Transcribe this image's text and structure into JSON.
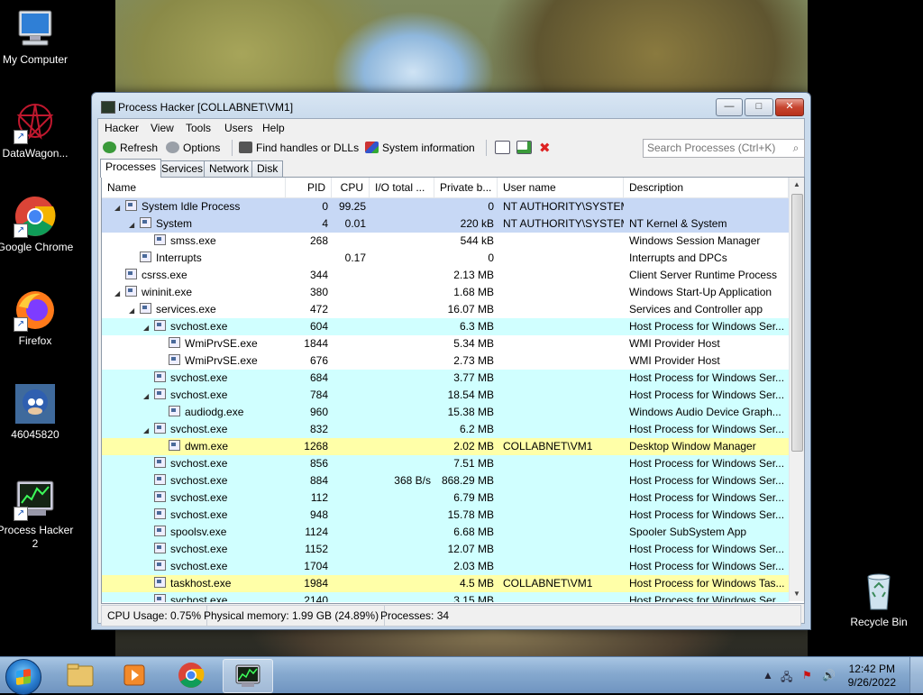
{
  "desktop": {
    "icons": [
      {
        "label": "My Computer",
        "icon": "computer-icon"
      },
      {
        "label": "DataWagon...",
        "icon": "datawagon-icon"
      },
      {
        "label": "Google Chrome",
        "icon": "chrome-icon"
      },
      {
        "label": "Firefox",
        "icon": "firefox-icon"
      },
      {
        "label": "46045820",
        "icon": "image-file-icon"
      },
      {
        "label": "Process Hacker 2",
        "icon": "process-hacker-icon"
      },
      {
        "label": "Recycle Bin",
        "icon": "recycle-bin-icon"
      }
    ]
  },
  "window": {
    "title": "Process Hacker [COLLABNET\\VM1]",
    "controls": {
      "minimize": "—",
      "maximize": "□",
      "close": "✕"
    },
    "menu": [
      "Hacker",
      "View",
      "Tools",
      "Users",
      "Help"
    ],
    "toolbar": {
      "refresh": "Refresh",
      "options": "Options",
      "find_handles": "Find handles or DLLs",
      "system_info": "System information",
      "search_placeholder": "Search Processes (Ctrl+K)"
    },
    "tabs": [
      "Processes",
      "Services",
      "Network",
      "Disk"
    ],
    "active_tab": "Processes",
    "columns": [
      "Name",
      "PID",
      "CPU",
      "I/O total ...",
      "Private b...",
      "User name",
      "Description"
    ],
    "rows": [
      {
        "name": "System Idle Process",
        "level": 0,
        "expander": "◢",
        "pid": "0",
        "cpu": "99.25",
        "io": "",
        "private": "0",
        "user": "NT AUTHORITY\\SYSTEM",
        "desc": "",
        "color": "#c7d8f5"
      },
      {
        "name": "System",
        "level": 1,
        "expander": "◢",
        "pid": "4",
        "cpu": "0.01",
        "io": "",
        "private": "220 kB",
        "user": "NT AUTHORITY\\SYSTEM",
        "desc": "NT Kernel & System",
        "color": "#c7d8f5"
      },
      {
        "name": "smss.exe",
        "level": 2,
        "expander": "",
        "pid": "268",
        "cpu": "",
        "io": "",
        "private": "544 kB",
        "user": "",
        "desc": "Windows Session Manager",
        "color": "#ffffff"
      },
      {
        "name": "Interrupts",
        "level": 1,
        "expander": "",
        "pid": "",
        "cpu": "0.17",
        "io": "",
        "private": "0",
        "user": "",
        "desc": "Interrupts and DPCs",
        "color": "#ffffff"
      },
      {
        "name": "csrss.exe",
        "level": 0,
        "expander": "",
        "pid": "344",
        "cpu": "",
        "io": "",
        "private": "2.13 MB",
        "user": "",
        "desc": "Client Server Runtime Process",
        "color": "#ffffff"
      },
      {
        "name": "wininit.exe",
        "level": 0,
        "expander": "◢",
        "pid": "380",
        "cpu": "",
        "io": "",
        "private": "1.68 MB",
        "user": "",
        "desc": "Windows Start-Up Application",
        "color": "#ffffff"
      },
      {
        "name": "services.exe",
        "level": 1,
        "expander": "◢",
        "pid": "472",
        "cpu": "",
        "io": "",
        "private": "16.07 MB",
        "user": "",
        "desc": "Services and Controller app",
        "color": "#ffffff"
      },
      {
        "name": "svchost.exe",
        "level": 2,
        "expander": "◢",
        "pid": "604",
        "cpu": "",
        "io": "",
        "private": "6.3 MB",
        "user": "",
        "desc": "Host Process for Windows Ser...",
        "color": "#d0ffff"
      },
      {
        "name": "WmiPrvSE.exe",
        "level": 3,
        "expander": "",
        "pid": "1844",
        "cpu": "",
        "io": "",
        "private": "5.34 MB",
        "user": "",
        "desc": "WMI Provider Host",
        "color": "#ffffff"
      },
      {
        "name": "WmiPrvSE.exe",
        "level": 3,
        "expander": "",
        "pid": "676",
        "cpu": "",
        "io": "",
        "private": "2.73 MB",
        "user": "",
        "desc": "WMI Provider Host",
        "color": "#ffffff"
      },
      {
        "name": "svchost.exe",
        "level": 2,
        "expander": "",
        "pid": "684",
        "cpu": "",
        "io": "",
        "private": "3.77 MB",
        "user": "",
        "desc": "Host Process for Windows Ser...",
        "color": "#d0ffff"
      },
      {
        "name": "svchost.exe",
        "level": 2,
        "expander": "◢",
        "pid": "784",
        "cpu": "",
        "io": "",
        "private": "18.54 MB",
        "user": "",
        "desc": "Host Process for Windows Ser...",
        "color": "#d0ffff"
      },
      {
        "name": "audiodg.exe",
        "level": 3,
        "expander": "",
        "pid": "960",
        "cpu": "",
        "io": "",
        "private": "15.38 MB",
        "user": "",
        "desc": "Windows Audio Device Graph...",
        "color": "#d0ffff"
      },
      {
        "name": "svchost.exe",
        "level": 2,
        "expander": "◢",
        "pid": "832",
        "cpu": "",
        "io": "",
        "private": "6.2 MB",
        "user": "",
        "desc": "Host Process for Windows Ser...",
        "color": "#d0ffff"
      },
      {
        "name": "dwm.exe",
        "level": 3,
        "expander": "",
        "pid": "1268",
        "cpu": "",
        "io": "",
        "private": "2.02 MB",
        "user": "COLLABNET\\VM1",
        "desc": "Desktop Window Manager",
        "color": "#ffffa8"
      },
      {
        "name": "svchost.exe",
        "level": 2,
        "expander": "",
        "pid": "856",
        "cpu": "",
        "io": "",
        "private": "7.51 MB",
        "user": "",
        "desc": "Host Process for Windows Ser...",
        "color": "#d0ffff"
      },
      {
        "name": "svchost.exe",
        "level": 2,
        "expander": "",
        "pid": "884",
        "cpu": "",
        "io": "368 B/s",
        "private": "868.29 MB",
        "user": "",
        "desc": "Host Process for Windows Ser...",
        "color": "#d0ffff"
      },
      {
        "name": "svchost.exe",
        "level": 2,
        "expander": "",
        "pid": "112",
        "cpu": "",
        "io": "",
        "private": "6.79 MB",
        "user": "",
        "desc": "Host Process for Windows Ser...",
        "color": "#d0ffff"
      },
      {
        "name": "svchost.exe",
        "level": 2,
        "expander": "",
        "pid": "948",
        "cpu": "",
        "io": "",
        "private": "15.78 MB",
        "user": "",
        "desc": "Host Process for Windows Ser...",
        "color": "#d0ffff"
      },
      {
        "name": "spoolsv.exe",
        "level": 2,
        "expander": "",
        "pid": "1124",
        "cpu": "",
        "io": "",
        "private": "6.68 MB",
        "user": "",
        "desc": "Spooler SubSystem App",
        "color": "#d0ffff"
      },
      {
        "name": "svchost.exe",
        "level": 2,
        "expander": "",
        "pid": "1152",
        "cpu": "",
        "io": "",
        "private": "12.07 MB",
        "user": "",
        "desc": "Host Process for Windows Ser...",
        "color": "#d0ffff"
      },
      {
        "name": "svchost.exe",
        "level": 2,
        "expander": "",
        "pid": "1704",
        "cpu": "",
        "io": "",
        "private": "2.03 MB",
        "user": "",
        "desc": "Host Process for Windows Ser...",
        "color": "#d0ffff"
      },
      {
        "name": "taskhost.exe",
        "level": 2,
        "expander": "",
        "pid": "1984",
        "cpu": "",
        "io": "",
        "private": "4.5 MB",
        "user": "COLLABNET\\VM1",
        "desc": "Host Process for Windows Tas...",
        "color": "#ffffa8"
      },
      {
        "name": "svchost.exe",
        "level": 2,
        "expander": "",
        "pid": "2140",
        "cpu": "",
        "io": "",
        "private": "3.15 MB",
        "user": "",
        "desc": "Host Process for Windows Ser...",
        "color": "#d0ffff"
      }
    ],
    "status": {
      "cpu": "CPU Usage: 0.75%",
      "memory": "Physical memory: 1.99 GB (24.89%)",
      "processes": "Processes: 34"
    }
  },
  "taskbar": {
    "apps": [
      "file-explorer-icon",
      "media-player-icon",
      "chrome-icon",
      "process-hacker-icon"
    ],
    "active_app": "process-hacker-icon",
    "clock_time": "12:42 PM",
    "clock_date": "9/26/2022",
    "tray_arrow": "▲"
  }
}
